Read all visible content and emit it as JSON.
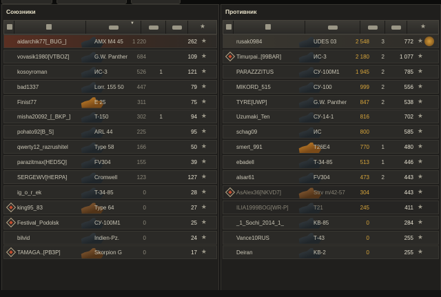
{
  "left": {
    "title": "Союзники",
    "rows": [
      {
        "player": "aidarchik77[_BUG_]",
        "tank": "AMX M4 45",
        "damage": "1 220",
        "kills": "",
        "xp": "262",
        "self": true
      },
      {
        "player": "vovasik1980[VTBOZ]",
        "tank": "G.W. Panther",
        "damage": "684",
        "kills": "",
        "xp": "109"
      },
      {
        "player": "kosoyroman",
        "tank": "ИС-3",
        "damage": "526",
        "kills": "1",
        "xp": "121"
      },
      {
        "player": "bad1337",
        "tank": "Lorr. 155 50",
        "damage": "447",
        "kills": "",
        "xp": "79"
      },
      {
        "player": "Finist77",
        "tank": "E 25",
        "damage": "311",
        "kills": "",
        "xp": "75",
        "gold": true
      },
      {
        "player": "misha20092_[_BKP_]",
        "tank": "T-150",
        "damage": "302",
        "kills": "1",
        "xp": "94"
      },
      {
        "player": "pohato92[B_S]",
        "tank": "ARL 44",
        "damage": "225",
        "kills": "",
        "xp": "95"
      },
      {
        "player": "qwerty12_razrushitel",
        "tank": "Type 58",
        "damage": "166",
        "kills": "",
        "xp": "50"
      },
      {
        "player": "parazitmax[HEDSQ]",
        "tank": "FV304",
        "damage": "155",
        "kills": "",
        "xp": "39"
      },
      {
        "player": "SERGEWV[HERPA]",
        "tank": "Cromwell",
        "damage": "123",
        "kills": "",
        "xp": "127"
      },
      {
        "player": "ig_o_r_ek",
        "tank": "T-34-85",
        "damage": "0",
        "kills": "",
        "xp": "28"
      },
      {
        "player": "king95_83",
        "tank": "Type 64",
        "damage": "0",
        "kills": "",
        "xp": "27",
        "platoon": true,
        "bronze": true
      },
      {
        "player": "Festival_Podolsk",
        "tank": "СУ-100М1",
        "damage": "0",
        "kills": "",
        "xp": "25",
        "platoon": true
      },
      {
        "player": "bilvid",
        "tank": "Indien-Pz.",
        "damage": "0",
        "kills": "",
        "xp": "24"
      },
      {
        "player": "TAMAGA..[РВЗР]",
        "tank": "Skorpion G",
        "damage": "0",
        "kills": "",
        "xp": "17",
        "platoon": true,
        "bronze": true
      }
    ]
  },
  "right": {
    "title": "Противник",
    "rows": [
      {
        "player": "rusak0984",
        "tank": "UDES 03",
        "damage": "2 548",
        "kills": "3",
        "xp": "772",
        "medal": true,
        "selfright": true
      },
      {
        "player": "Timurpai..[99BAR]",
        "tank": "ИС-3",
        "damage": "2 180",
        "kills": "2",
        "xp": "1 077",
        "platoon": true
      },
      {
        "player": "PARAZZZITUS",
        "tank": "СУ-100М1",
        "damage": "1 945",
        "kills": "2",
        "xp": "785"
      },
      {
        "player": "MIKORD_515",
        "tank": "СУ-100",
        "damage": "999",
        "kills": "2",
        "xp": "556"
      },
      {
        "player": "TYRE[UWP]",
        "tank": "G.W. Panther",
        "damage": "847",
        "kills": "2",
        "xp": "538"
      },
      {
        "player": "Uzumaki_Ten",
        "tank": "СУ-14-1",
        "damage": "816",
        "kills": "",
        "xp": "702"
      },
      {
        "player": "schag09",
        "tank": "ИС",
        "damage": "800",
        "kills": "",
        "xp": "585"
      },
      {
        "player": "smert_991",
        "tank": "T26E4",
        "damage": "770",
        "kills": "1",
        "xp": "480",
        "gold": true
      },
      {
        "player": "ebadell",
        "tank": "T-34-85",
        "damage": "513",
        "kills": "1",
        "xp": "446"
      },
      {
        "player": "alsar61",
        "tank": "FV304",
        "damage": "473",
        "kills": "2",
        "xp": "443"
      },
      {
        "player": "AsAlex36[NKVD7]",
        "tank": "Strv m/42-57",
        "damage": "304",
        "kills": "",
        "xp": "443",
        "platoon": true,
        "dead": true,
        "bronze": true
      },
      {
        "player": "ILIA1999BOG[WR-P]",
        "tank": "T21",
        "damage": "245",
        "kills": "",
        "xp": "411",
        "dead": true
      },
      {
        "player": "_1_Sochi_2014_1_",
        "tank": "KB-85",
        "damage": "0",
        "kills": "",
        "xp": "284"
      },
      {
        "player": "Vance10RUS",
        "tank": "T-43",
        "damage": "0",
        "kills": "",
        "xp": "255"
      },
      {
        "player": "Deiran",
        "tank": "KB-2",
        "damage": "0",
        "kills": "",
        "xp": "255"
      }
    ]
  }
}
